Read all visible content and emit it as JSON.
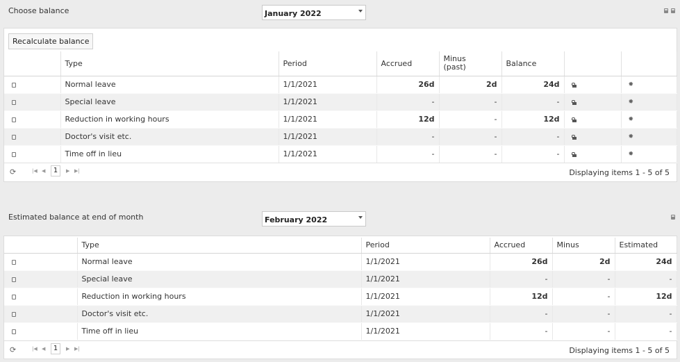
{
  "top": {
    "label": "Choose balance",
    "period_select": "January 2022",
    "recalculate_label": "Recalculate balance",
    "columns": [
      "",
      "Type",
      "Period",
      "Accrued",
      "Minus\n(past)",
      "Balance",
      "",
      ""
    ],
    "rows": [
      {
        "type": "Normal leave",
        "period": "1/1/2021",
        "accrued": "26d",
        "minus": "2d",
        "balance": "24d"
      },
      {
        "type": "Special leave",
        "period": "1/1/2021",
        "accrued": "-",
        "minus": "-",
        "balance": "-"
      },
      {
        "type": "Reduction in working hours",
        "period": "1/1/2021",
        "accrued": "12d",
        "minus": "-",
        "balance": "12d"
      },
      {
        "type": "Doctor's visit etc.",
        "period": "1/1/2021",
        "accrued": "-",
        "minus": "-",
        "balance": "-"
      },
      {
        "type": "Time off in lieu",
        "period": "1/1/2021",
        "accrued": "-",
        "minus": "-",
        "balance": "-"
      }
    ],
    "pager": {
      "page": "1",
      "display": "Displaying items 1 - 5 of 5"
    }
  },
  "bottom": {
    "label": "Estimated balance at end of month",
    "period_select": "February 2022",
    "columns": [
      "",
      "Type",
      "Period",
      "Accrued",
      "Minus",
      "Estimated"
    ],
    "rows": [
      {
        "type": "Normal leave",
        "period": "1/1/2021",
        "accrued": "26d",
        "minus": "2d",
        "estimated": "24d"
      },
      {
        "type": "Special leave",
        "period": "1/1/2021",
        "accrued": "-",
        "minus": "-",
        "estimated": "-"
      },
      {
        "type": "Reduction in working hours",
        "period": "1/1/2021",
        "accrued": "12d",
        "minus": "-",
        "estimated": "12d"
      },
      {
        "type": "Doctor's visit etc.",
        "period": "1/1/2021",
        "accrued": "-",
        "minus": "-",
        "estimated": "-"
      },
      {
        "type": "Time off in lieu",
        "period": "1/1/2021",
        "accrued": "-",
        "minus": "-",
        "estimated": "-"
      }
    ],
    "pager": {
      "page": "1",
      "display": "Displaying items 1 - 5 of 5"
    }
  },
  "icons": {
    "row": "document-icon",
    "lock": "lock-icon",
    "settings": "gear-icon",
    "refresh": "refresh-icon",
    "print": "print-icon",
    "delete": "trash-icon"
  }
}
